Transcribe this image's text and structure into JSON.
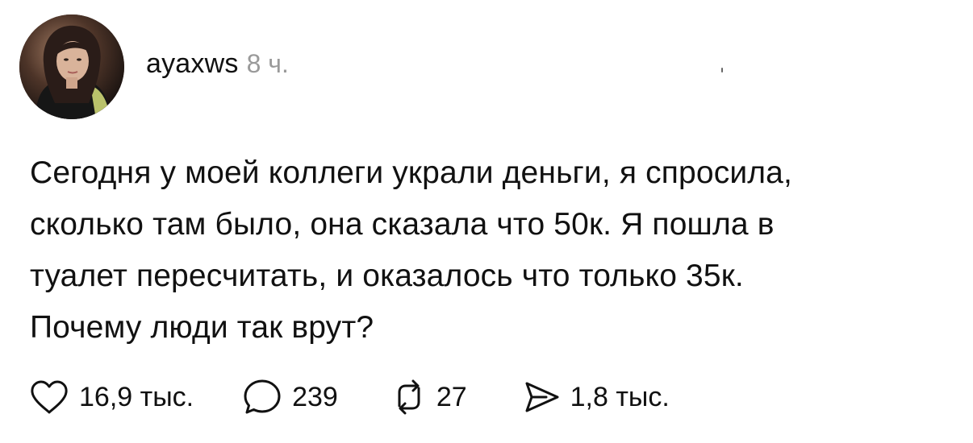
{
  "post": {
    "author": {
      "username": "ayaxws",
      "time": "8 ч."
    },
    "text": {
      "lines": [
        "Сегодня у моей коллеги украли деньги, я спросила,",
        "сколько там было, она сказала что 50к. Я пошла в",
        "туалет пересчитать, и оказалось что только 35к.",
        "Почему люди так врут?"
      ]
    },
    "actions": {
      "likes": {
        "icon": "heart-icon",
        "count": "16,9 тыс."
      },
      "comments": {
        "icon": "comment-icon",
        "count": "239"
      },
      "reposts": {
        "icon": "repost-icon",
        "count": "27"
      },
      "shares": {
        "icon": "share-icon",
        "count": "1,8 тыс."
      }
    }
  }
}
